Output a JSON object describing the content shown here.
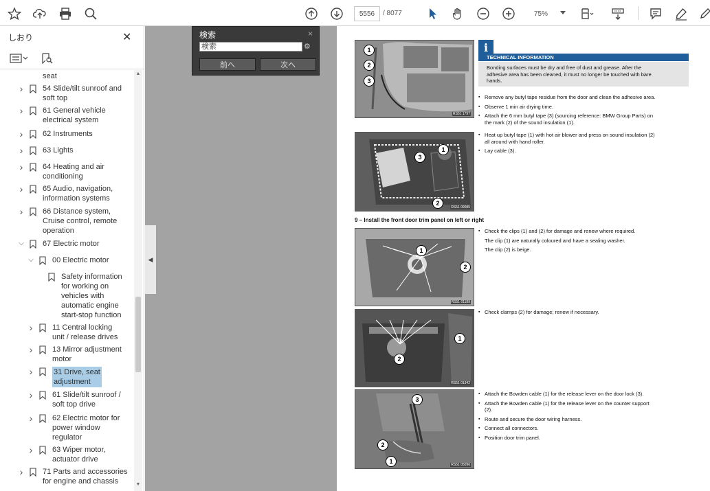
{
  "toolbar": {
    "page_current": "5556",
    "page_total": "/ 8077",
    "zoom": "75%"
  },
  "sidebar": {
    "title": "しおり",
    "close": "✕",
    "items": [
      {
        "label": "seat",
        "indent": 0,
        "expander": "none"
      },
      {
        "label": "54 Slide/tilt sunroof and\nsoft top",
        "indent": 0,
        "expander": "right"
      },
      {
        "label": "61 General vehicle\nelectrical system",
        "indent": 0,
        "expander": "right"
      },
      {
        "label": "62 Instruments",
        "indent": 0,
        "expander": "right"
      },
      {
        "label": "63 Lights",
        "indent": 0,
        "expander": "right"
      },
      {
        "label": "64 Heating and air\nconditioning",
        "indent": 0,
        "expander": "right"
      },
      {
        "label": "65 Audio, navigation,\ninformation systems",
        "indent": 0,
        "expander": "right"
      },
      {
        "label": "66 Distance system,\nCruise control, remote\noperation",
        "indent": 0,
        "expander": "right"
      },
      {
        "label": "67 Electric motor",
        "indent": 0,
        "expander": "down"
      },
      {
        "label": "00 Electric motor",
        "indent": 1,
        "expander": "down"
      },
      {
        "label": "Safety information\nfor working on\nvehicles with\nautomatic engine\nstart-stop function",
        "indent": 2,
        "expander": "none"
      },
      {
        "label": "11 Central locking\nunit / release drives",
        "indent": 1,
        "expander": "right"
      },
      {
        "label": "13 Mirror adjustment\nmotor",
        "indent": 1,
        "expander": "right"
      },
      {
        "label": "31 Drive, seat\nadjustment",
        "indent": 1,
        "expander": "right",
        "selected": true
      },
      {
        "label": "61 Slide/tilt sunroof /\nsoft top drive",
        "indent": 1,
        "expander": "right"
      },
      {
        "label": "62 Electric motor for\npower window\nregulator",
        "indent": 1,
        "expander": "right"
      },
      {
        "label": "63 Wiper motor,\nactuator drive",
        "indent": 1,
        "expander": "right"
      },
      {
        "label": "71 Parts and accessories\nfor engine and chassis",
        "indent": 0,
        "expander": "right"
      }
    ]
  },
  "search": {
    "title": "検索",
    "close": "×",
    "placeholder": "検索",
    "prev": "前へ",
    "next": "次へ"
  },
  "document": {
    "tech_info": {
      "heading": "TECHNICAL INFORMATION",
      "body": "Bonding surfaces must be dry and free of dust and grease. After the\nadhesive area has been cleaned, it must no longer be touched with bare\nhands."
    },
    "block1": [
      "Remove any butyl tape residue from the door and clean the adhesive area.",
      "Observe 1 min air drying time.",
      "Attach the 6 mm butyl tape (3) (sourcing reference: BMW Group Parts) on\nthe mark (2) of the sound insulation (1)."
    ],
    "block2": [
      "Heat up butyl tape (1) with hot air blower and press on sound insulation (2)\nall around with hand roller.",
      "Lay cable (3)."
    ],
    "step9": "9 – Install the front door trim panel on left or right",
    "block3": [
      "Check the clips (1) and (2) for damage and renew where required."
    ],
    "block3_notes": [
      "The clip (1) are naturally coloured and have a sealing washer.",
      "The clip (2) is beige."
    ],
    "block4": [
      "Check clamps (2) for damage; renew if necessary."
    ],
    "block5": [
      "Attach the Bowden cable (1) for the release lever on the door lock (3).",
      "Attach the Bowden cable (1) for the release lever on the counter support\n(2).",
      "Route and secure the door wiring harness.",
      "Connect all connectors.",
      "Position door trim panel."
    ],
    "photo_codes": [
      "RS51 1797",
      "RS51 09085",
      "RS51 01189",
      "RS51 01342",
      "RS51 05096"
    ]
  }
}
